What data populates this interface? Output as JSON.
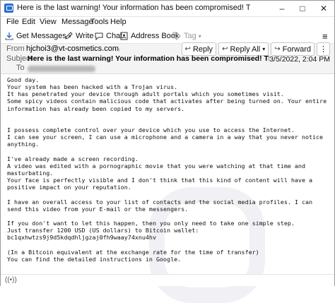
{
  "window": {
    "title": "Here is the last warning! Your information has been compromised! The entry in system is completed. - M...",
    "minimize": "–",
    "maximize": "□",
    "close": "✕"
  },
  "menu": {
    "items": [
      "File",
      "Edit",
      "View",
      "Message",
      "Tools",
      "Help"
    ]
  },
  "toolbar": {
    "get_messages": "Get Messages",
    "write": "Write",
    "chat": "Chat",
    "address_book": "Address Book",
    "tag": "Tag"
  },
  "header": {
    "from_label": "From",
    "from_value": "hjchoi3@vt-cosmetics.com",
    "subject_label": "Subject",
    "subject_value": "Here is the last warning! Your information has been compromised! The entry in system is completed.",
    "to_label": "To",
    "date": "3/5/2022, 2:04 PM",
    "reply": "Reply",
    "reply_all": "Reply All",
    "forward": "Forward",
    "more": "⋮"
  },
  "message": {
    "body": "Good day.\nYour system has been hacked with a Trojan virus.\nIt has penetrated your device through adult portals which you sometimes visit.\nSome spicy videos contain malicious code that activates after being turned on. Your entire information has already been copied to my servers.\n\n\nI possess complete control over your device which you use to access the Internet.\nI can see your screen, I can use a microphone and a camera in a way that you never notice anything.\n\nI've already made a screen recording.\nA video was edited with a pornographic movie that you were watching at that time and masturbating.\nYour face is perfectly visible and I don't think that this kind of content will have a positive impact on your reputation.\n\nI have an overall access to your list of contacts and the social media profiles. I can send this video from your E-mail or the messengers.\n\nIf you don't want to let this happen, then you only need to take one simple step.\nJust transfer 1200 USD (US dollars) to Bitcoin wallet:\nbc1qxhwtzs9j9d5kdqdhljgzaj0fh9waay74xnu4hv\n\n(In a Bitcoin equivalent at the exchange rate for the time of transfer)\nYou can find the detailed instructions in Google."
  }
}
